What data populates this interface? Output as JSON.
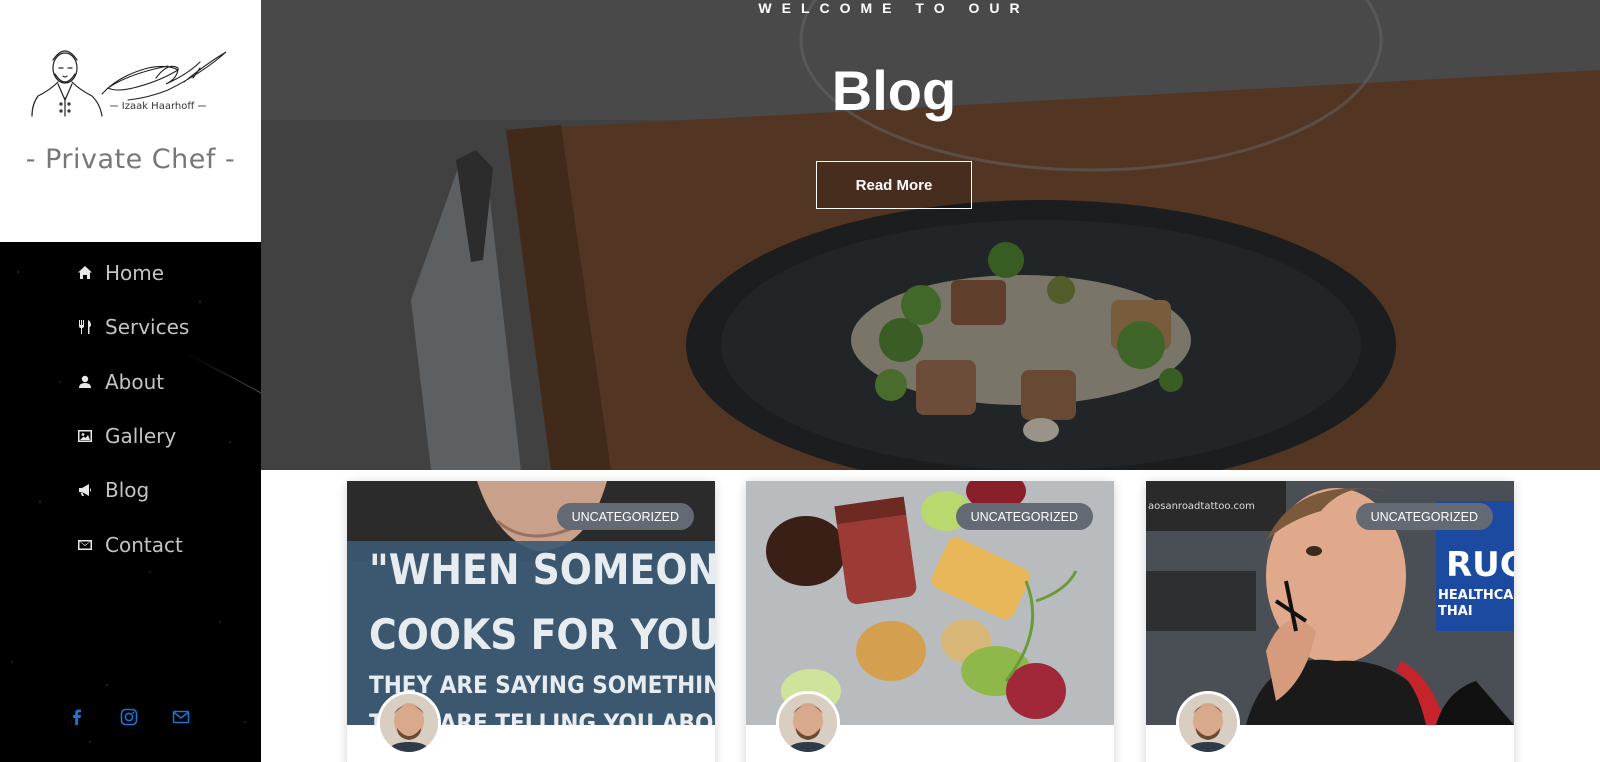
{
  "brand": {
    "signature_text": "Izaak Haarhoff",
    "title": "- Private Chef -"
  },
  "nav": {
    "items": [
      {
        "label": "Home",
        "icon": "home-icon"
      },
      {
        "label": "Services",
        "icon": "utensils-icon"
      },
      {
        "label": "About",
        "icon": "person-icon"
      },
      {
        "label": "Gallery",
        "icon": "image-icon"
      },
      {
        "label": "Blog",
        "icon": "megaphone-icon"
      },
      {
        "label": "Contact",
        "icon": "envelope-icon"
      }
    ]
  },
  "socials": [
    {
      "icon": "facebook-icon"
    },
    {
      "icon": "instagram-icon"
    },
    {
      "icon": "mail-icon"
    }
  ],
  "hero": {
    "kicker": "WELCOME TO OUR",
    "title": "Blog",
    "button_label": "Read More"
  },
  "posts": [
    {
      "category": "UNCATEGORIZED",
      "image_text": [
        "\"WHEN SOMEONE",
        "COOKS FOR YOU,",
        "THEY ARE SAYING SOMETHING.",
        "THEY ARE TELLING YOU ABOUT"
      ]
    },
    {
      "category": "UNCATEGORIZED"
    },
    {
      "category": "UNCATEGORIZED",
      "image_text": [
        "aosanroadtattoo.com",
        "RUG",
        "HEALTHCAR",
        "THAI"
      ]
    }
  ],
  "colors": {
    "sidebar_bg": "#000000",
    "badge_bg": "#636a73",
    "social_icon": "#1e73d6",
    "nav_text": "#c4c4c4"
  }
}
